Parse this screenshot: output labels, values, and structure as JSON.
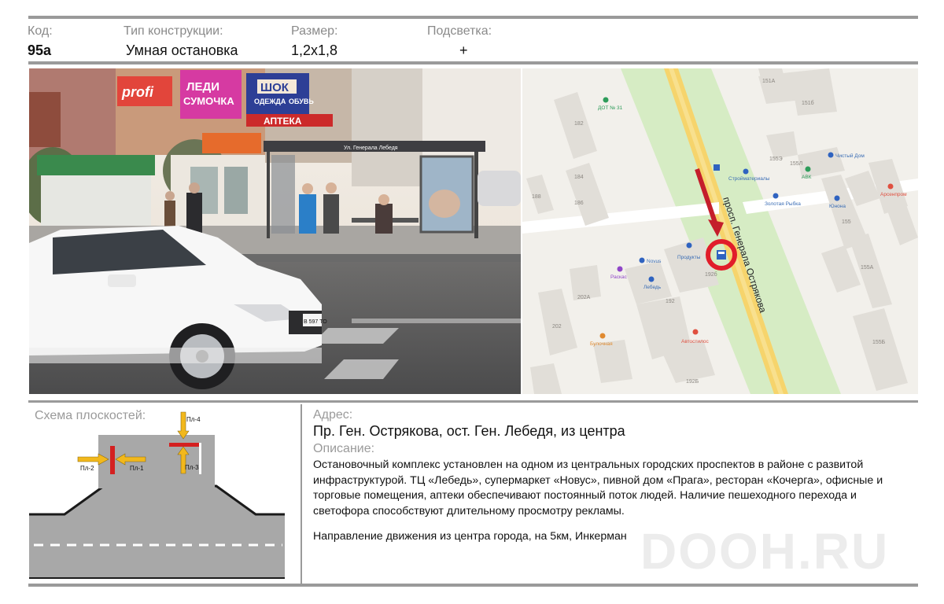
{
  "header": {
    "code_label": "Код:",
    "code_value": "95а",
    "type_label": "Тип конструкции:",
    "type_value": "Умная остановка",
    "size_label": "Размер:",
    "size_value": "1,2х1,8",
    "light_label": "Подсветка:",
    "light_value": "+"
  },
  "photo": {
    "sign_1": "ЛЕДИ",
    "sign_1b": "СУМОЧКА",
    "sign_2": "ШОК",
    "sign_2b": "ОДЕЖДА",
    "sign_2c": "ОБУВЬ",
    "sign_3": "АПТЕКА",
    "sign_4": "profi",
    "stop_name": "Ул. Генерала Лебедя",
    "car_plate": "В 597 ТО"
  },
  "map": {
    "street_name": "просп. Генерала Острякова",
    "places": [
      {
        "name": "ДОТ № 31"
      },
      {
        "name": "Стройматериалы"
      },
      {
        "name": "Золотая Рыбка"
      },
      {
        "name": "АВК"
      },
      {
        "name": "Чистый Дом"
      },
      {
        "name": "Юнона"
      },
      {
        "name": "Арсенпром"
      },
      {
        "name": "Продукты"
      },
      {
        "name": "Раскас"
      },
      {
        "name": "Лебедь"
      },
      {
        "name": "Novus"
      },
      {
        "name": "Булочная"
      },
      {
        "name": "Автостилос"
      }
    ],
    "house_numbers": [
      "151А",
      "151б",
      "182",
      "184",
      "186",
      "188",
      "155Э",
      "155Л",
      "155",
      "155А",
      "192б",
      "202А",
      "202",
      "192",
      "192Б",
      "155Б"
    ],
    "colors": {
      "marker": "#e11d2a",
      "road": "#f5d36a",
      "park": "#d4ecc3"
    }
  },
  "scheme": {
    "title": "Схема плоскостей:",
    "planes": [
      "Пл-1",
      "Пл-2",
      "Пл-3",
      "Пл-4"
    ],
    "colors": {
      "plane": "#d42020",
      "arrow": "#f2b81c",
      "road": "#a8a8a8"
    }
  },
  "info": {
    "address_label": "Адрес:",
    "address": "Пр. Ген. Острякова,  ост. Ген. Лебедя, из центра",
    "description_label": "Описание:",
    "description": "Остановочный комплекс установлен на одном из центральных городских проспектов в районе с развитой инфраструктурой. ТЦ «Лебедь», супермаркет «Новус», пивной дом «Прага», ресторан «Кочерга», офисные и торговые помещения, аптеки обеспечивают постоянный поток людей. Наличие пешеходного перехода и светофора способствуют длительному просмотру рекламы.",
    "direction": "Направление движения из центра города, на 5км, Инкерман",
    "watermark": "DOOH.RU"
  }
}
